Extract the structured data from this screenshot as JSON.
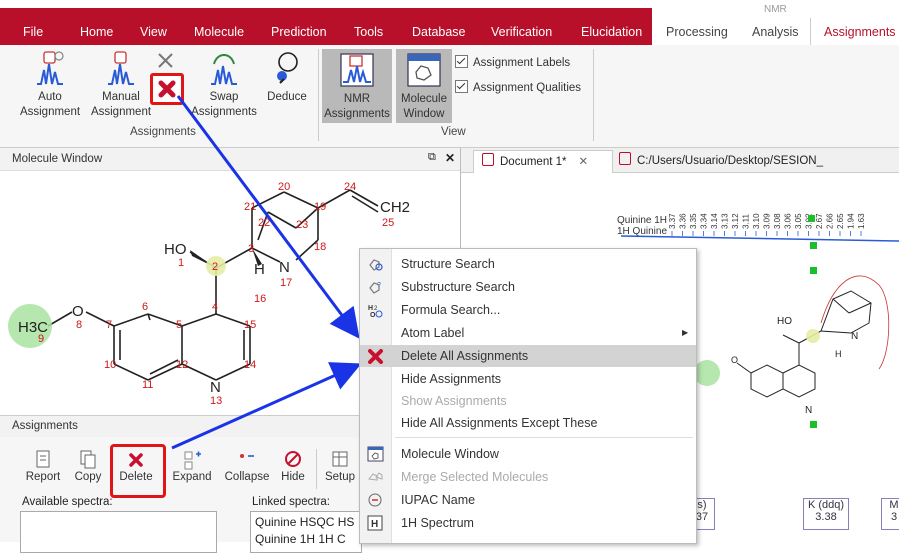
{
  "menubar": {
    "items": [
      "File",
      "Home",
      "View",
      "Molecule",
      "Prediction",
      "Tools",
      "Database",
      "Verification",
      "Elucidation"
    ],
    "right_tabs": [
      "Processing",
      "Analysis",
      "Assignments"
    ],
    "context_header": "NMR"
  },
  "ribbon": {
    "assignments_group": {
      "label": "Assignments",
      "buttons": [
        {
          "line1": "Auto",
          "line2": "Assignment"
        },
        {
          "line1": "Manual",
          "line2": "Assignment"
        },
        {
          "line1": "Swap",
          "line2": "Assignments"
        },
        {
          "line1": "Deduce",
          "line2": ""
        }
      ]
    },
    "view_group": {
      "label": "View",
      "buttons": [
        {
          "line1": "NMR",
          "line2": "Assignments"
        },
        {
          "line1": "Molecule",
          "line2": "Window"
        }
      ],
      "checkboxes": [
        "Assignment Labels",
        "Assignment Qualities"
      ]
    }
  },
  "molecule_window": {
    "title": "Molecule Window",
    "atoms": {
      "oh": "HO",
      "ch2": "CH2",
      "h3c": "H3C",
      "o": "O",
      "n17": "N",
      "n13": "N",
      "h": "H"
    },
    "numbers": [
      "1",
      "2",
      "3",
      "4",
      "5",
      "6",
      "7",
      "8",
      "9",
      "10",
      "11",
      "12",
      "13",
      "14",
      "15",
      "16",
      "17",
      "18",
      "19",
      "20",
      "21",
      "22",
      "23",
      "24",
      "25"
    ]
  },
  "assignments_panel": {
    "title": "Assignments",
    "buttons": [
      "Report",
      "Copy",
      "Delete",
      "Expand",
      "Collapse",
      "Hide",
      "Setup"
    ],
    "available_label": "Available spectra:",
    "linked_label": "Linked spectra:",
    "linked_items": [
      "Quinine HSQC HS",
      "Quinine 1H 1H C"
    ]
  },
  "doc_tabs": [
    {
      "label": "Document 1*"
    },
    {
      "label": "C:/Users/Usuario/Desktop/SESION_"
    }
  ],
  "spectrum": {
    "labels": [
      "Quinine 1H",
      "1H Quinine"
    ],
    "peaks": [
      "3.37",
      "3.36",
      "3.35",
      "3.34",
      "3.14",
      "3.13",
      "3.12",
      "3.11",
      "3.10",
      "3.09",
      "3.08",
      "3.06",
      "3.05",
      "3.02",
      "2.67",
      "2.66",
      "2.65",
      "1.94",
      "1.63"
    ],
    "boxes": [
      {
        "title": "s)",
        "value": "37"
      },
      {
        "title": "K (ddq)",
        "value": "3.38"
      },
      {
        "title": "M",
        "value": "3"
      }
    ]
  },
  "context_menu": {
    "items": [
      {
        "label": "Structure Search",
        "icon": "structure-search-icon"
      },
      {
        "label": "Substructure Search",
        "icon": "substructure-search-icon"
      },
      {
        "label": "Formula Search...",
        "icon": "formula-search-icon"
      },
      {
        "label": "Atom Label",
        "icon": "",
        "submenu": true
      },
      {
        "label": "Delete All Assignments",
        "icon": "delete-assignments-icon",
        "selected": true
      },
      {
        "label": "Hide Assignments",
        "icon": ""
      },
      {
        "label": "Show Assignments",
        "icon": "",
        "disabled": true
      },
      {
        "label": "Hide All Assignments Except These",
        "icon": ""
      },
      {
        "label": "Molecule Window",
        "icon": "molecule-window-icon"
      },
      {
        "label": "Merge Selected Molecules",
        "icon": "merge-icon",
        "disabled": true
      },
      {
        "label": "IUPAC Name",
        "icon": "iupac-icon"
      },
      {
        "label": "1H Spectrum",
        "icon": "1h-spectrum-icon"
      }
    ]
  },
  "colors": {
    "brand_red": "#b8102a",
    "annotation_blue": "#1a33e6",
    "highlight_red": "#e01515"
  }
}
